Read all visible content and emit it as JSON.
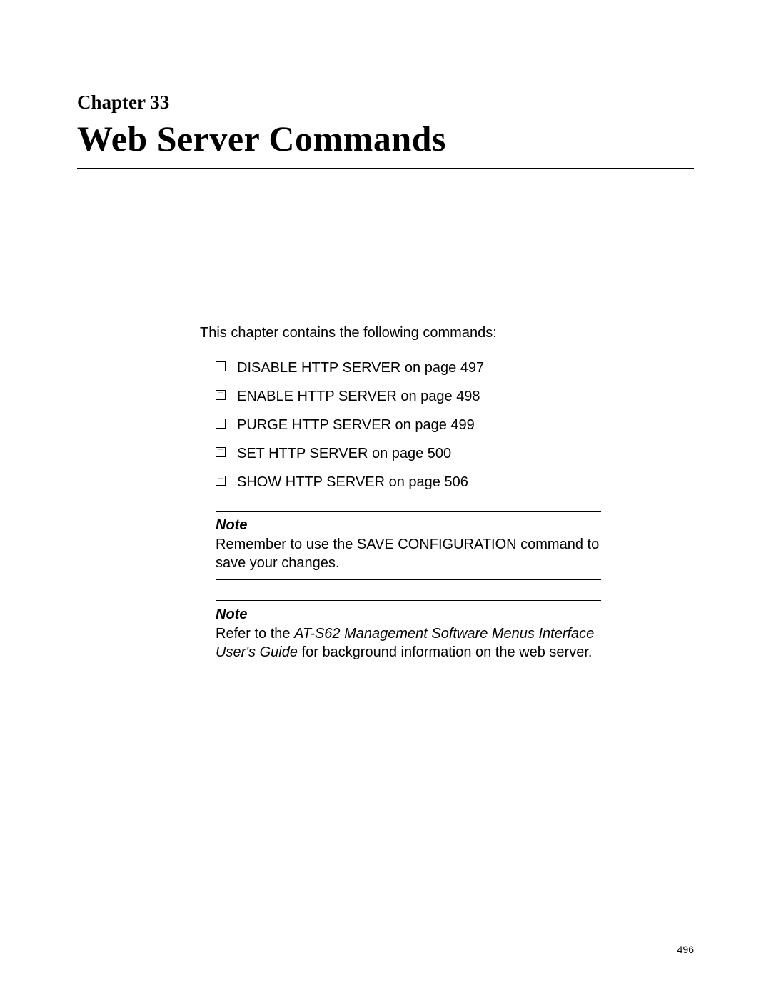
{
  "header": {
    "chapter_label": "Chapter 33",
    "chapter_title": "Web Server Commands"
  },
  "body": {
    "intro": "This chapter contains the following commands:",
    "commands": [
      "DISABLE HTTP SERVER on page 497",
      "ENABLE HTTP SERVER on page 498",
      "PURGE HTTP SERVER on page 499",
      "SET HTTP SERVER on page 500",
      "SHOW HTTP SERVER on page 506"
    ],
    "notes": [
      {
        "title": "Note",
        "body_plain": "Remember to use the SAVE CONFIGURATION command to save your changes."
      },
      {
        "title": "Note",
        "body_prefix": "Refer to the ",
        "body_italic": "AT-S62 Management Software Menus Interface User's Guide",
        "body_suffix": " for background information on the web server."
      }
    ]
  },
  "footer": {
    "page_number": "496"
  }
}
